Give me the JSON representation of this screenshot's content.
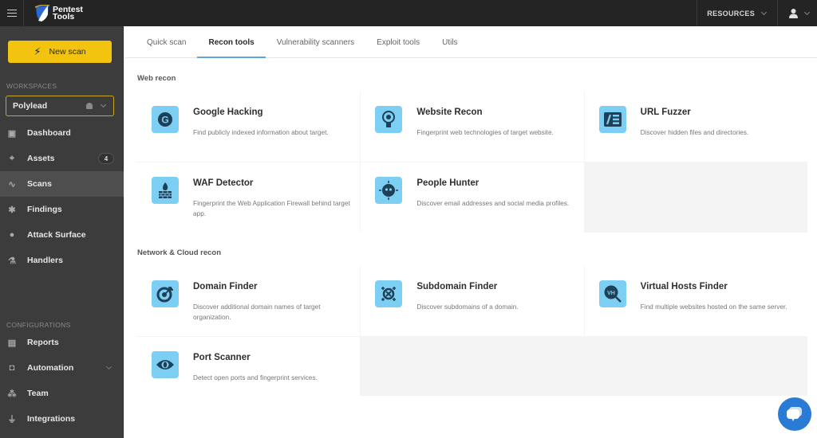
{
  "header": {
    "logo_line1": "Pentest",
    "logo_line2": "Tools",
    "resources_label": "RESOURCES"
  },
  "sidebar": {
    "new_scan_label": "New scan",
    "workspaces_label": "WORKSPACES",
    "workspace_name": "Polylead",
    "items": [
      {
        "label": "Dashboard",
        "icon": "dashboard-icon"
      },
      {
        "label": "Assets",
        "icon": "crosshair-icon",
        "badge": "4"
      },
      {
        "label": "Scans",
        "icon": "pulse-icon",
        "active": true
      },
      {
        "label": "Findings",
        "icon": "bug-icon"
      },
      {
        "label": "Attack Surface",
        "icon": "compass-icon"
      },
      {
        "label": "Handlers",
        "icon": "flask-icon"
      }
    ],
    "configurations_label": "CONFIGURATIONS",
    "config_items": [
      {
        "label": "Reports",
        "icon": "reports-icon"
      },
      {
        "label": "Automation",
        "icon": "robot-icon"
      },
      {
        "label": "Team",
        "icon": "team-icon"
      },
      {
        "label": "Integrations",
        "icon": "plug-icon"
      }
    ]
  },
  "tabs": [
    {
      "label": "Quick scan"
    },
    {
      "label": "Recon tools",
      "active": true
    },
    {
      "label": "Vulnerability scanners"
    },
    {
      "label": "Exploit tools"
    },
    {
      "label": "Utils"
    }
  ],
  "groups": [
    {
      "title": "Web recon",
      "tools": [
        {
          "title": "Google Hacking",
          "desc": "Find publicly indexed information about target.",
          "icon": "google-icon"
        },
        {
          "title": "Website Recon",
          "desc": "Fingerprint web technologies of target website.",
          "icon": "website-recon-icon"
        },
        {
          "title": "URL Fuzzer",
          "desc": "Discover hidden files and directories.",
          "icon": "url-fuzzer-icon"
        },
        {
          "title": "WAF Detector",
          "desc": "Fingerprint the Web Application Firewall behind target app.",
          "icon": "firewall-icon"
        },
        {
          "title": "People Hunter",
          "desc": "Discover email addresses and social media profiles.",
          "icon": "people-hunter-icon"
        }
      ]
    },
    {
      "title": "Network & Cloud recon",
      "tools": [
        {
          "title": "Domain Finder",
          "desc": "Discover additional domain names of target organization.",
          "icon": "domain-finder-icon"
        },
        {
          "title": "Subdomain Finder",
          "desc": "Discover subdomains of a domain.",
          "icon": "subdomain-finder-icon"
        },
        {
          "title": "Virtual Hosts Finder",
          "desc": "Find multiple websites hosted on the same server.",
          "icon": "virtual-hosts-icon",
          "icon_text": "VH"
        },
        {
          "title": "Port Scanner",
          "desc": "Detect open ports and fingerprint services.",
          "icon": "eye-icon"
        }
      ]
    }
  ],
  "colors": {
    "accent_yellow": "#f2c40f",
    "tab_underline": "#5aa6e0",
    "icon_bg": "#7ccff3",
    "icon_fg": "#1e3f55",
    "chat_blue": "#2a7bd6"
  }
}
